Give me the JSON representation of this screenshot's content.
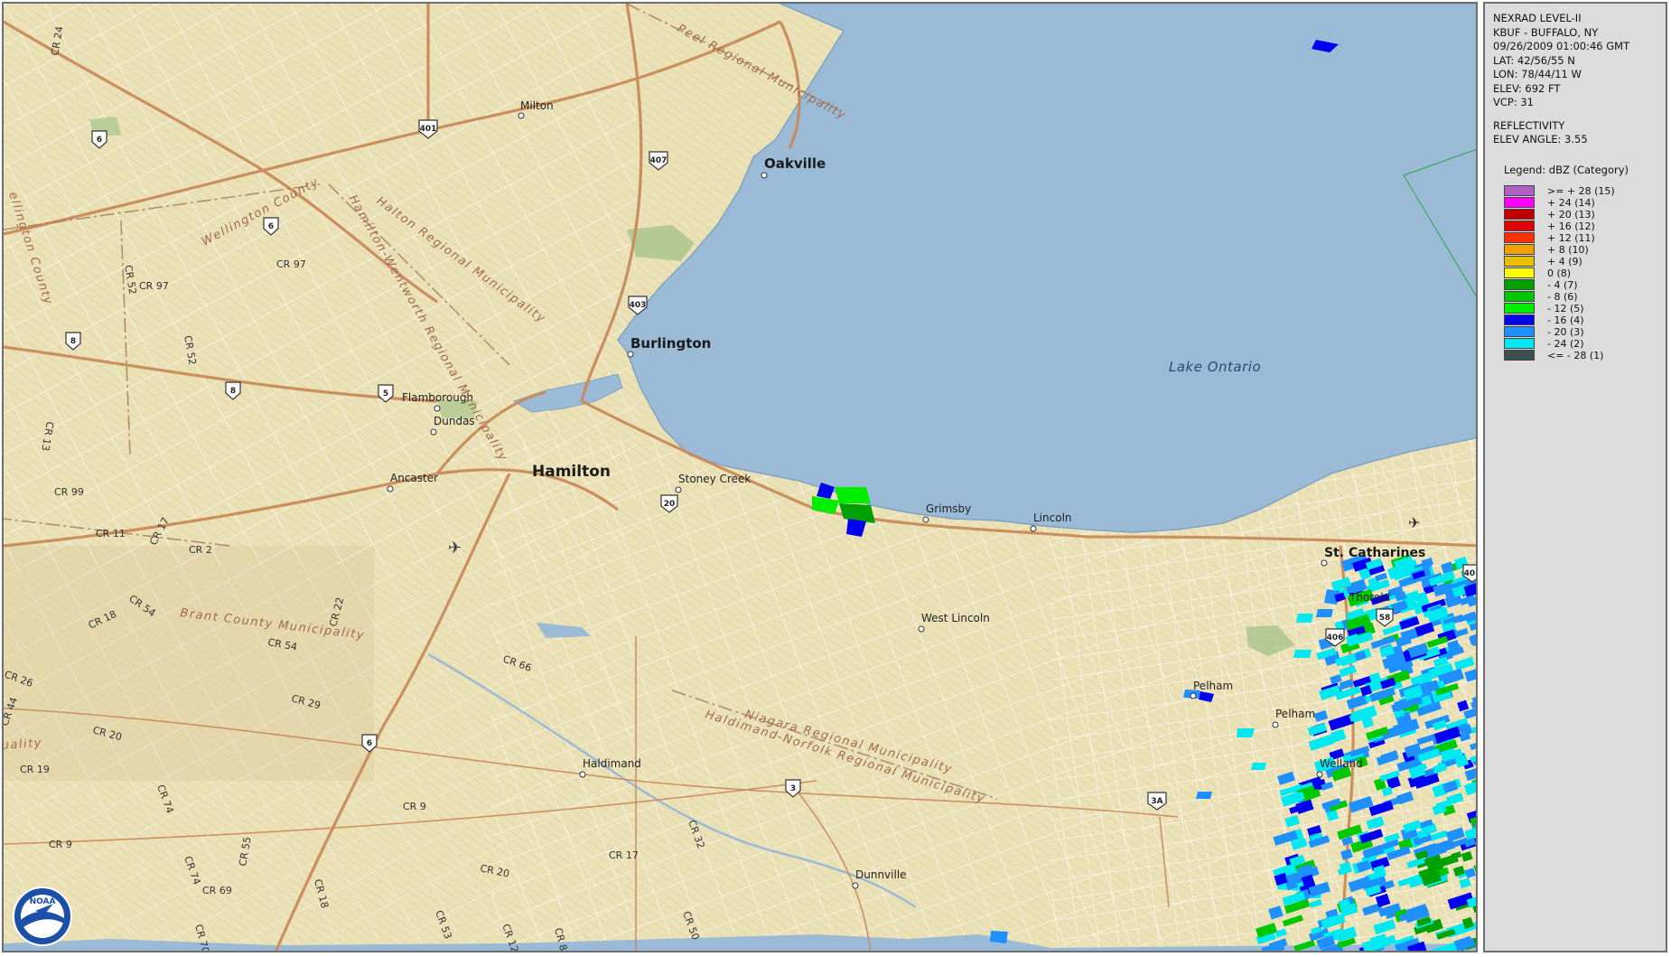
{
  "radar_info": {
    "lines_1": [
      "NEXRAD LEVEL-II",
      "KBUF - BUFFALO, NY",
      "09/26/2009 01:00:46 GMT",
      "LAT: 42/56/55 N",
      "LON: 78/44/11 W",
      "ELEV: 692 FT",
      "VCP: 31"
    ],
    "lines_2": [
      "REFLECTIVITY",
      "ELEV ANGLE: 3.55"
    ]
  },
  "legend": {
    "title": "Legend: dBZ (Category)",
    "items": [
      {
        "label": ">= + 28 (15)",
        "color": "#b060c8"
      },
      {
        "label": "+ 24 (14)",
        "color": "#ff00ff"
      },
      {
        "label": "+ 20 (13)",
        "color": "#c00000"
      },
      {
        "label": "+ 16 (12)",
        "color": "#e00000"
      },
      {
        "label": "+ 12 (11)",
        "color": "#ff3000"
      },
      {
        "label": "+ 8 (10)",
        "color": "#f0a000"
      },
      {
        "label": "+ 4 (9)",
        "color": "#e8c000"
      },
      {
        "label": "0 (8)",
        "color": "#ffff00"
      },
      {
        "label": "- 4 (7)",
        "color": "#00a000"
      },
      {
        "label": "- 8 (6)",
        "color": "#00c800"
      },
      {
        "label": "- 12 (5)",
        "color": "#00ee00"
      },
      {
        "label": "- 16 (4)",
        "color": "#0000f0"
      },
      {
        "label": "- 20 (3)",
        "color": "#1e90ff"
      },
      {
        "label": "- 24 (2)",
        "color": "#00e8f0"
      },
      {
        "label": "<= - 28 (1)",
        "color": "#3c5050"
      }
    ]
  },
  "map": {
    "lake_label": "Lake Ontario",
    "cities": {
      "milton": "Milton",
      "oakville": "Oakville",
      "burlington": "Burlington",
      "flamborough": "Flamborough",
      "dundas": "Dundas",
      "ancaster": "Ancaster",
      "hamilton": "Hamilton",
      "stoney_creek": "Stoney Creek",
      "grimsby": "Grimsby",
      "lincoln": "Lincoln",
      "st_catharines": "St. Catharines",
      "thorold": "Thorold",
      "west_lincoln": "West Lincoln",
      "pelham_1": "Pelham",
      "pelham_2": "Pelham",
      "welland": "Welland",
      "haldimand": "Haldimand",
      "dunnville": "Dunnville"
    },
    "regions": {
      "peel": "Peel Regional Municipality",
      "halton": "Halton Regional Municipality",
      "hamilton_wentworth": "Hamilton-Wentworth Regional Municipality",
      "wellington": "Wellington County",
      "wellington_2": "ellington County",
      "brant": "Brant County Municipality",
      "niagara": "Niagara Regional Municipality",
      "haldimand_norfolk": "Haldimand-Norfolk Regional Municipality",
      "left_edge": "uality"
    },
    "county_roads": {
      "cr24": "CR 24",
      "cr97a": "CR 97",
      "cr52a": "CR 52",
      "cr97b": "CR 97",
      "cr52b": "CR 52",
      "cr13": "CR 13",
      "cr99": "CR 99",
      "cr11": "CR 11",
      "cr17": "CR 17",
      "cr2": "CR 2",
      "cr54a": "CR 54",
      "cr18": "CR 18",
      "cr22": "CR 22",
      "cr54b": "CR 54",
      "cr26": "CR 26",
      "cr44": "CR 44",
      "cr29": "CR 29",
      "cr20a": "CR 20",
      "cr66": "CR 66",
      "cr19": "CR 19",
      "cr74a": "CR 74",
      "cr9a": "CR 9",
      "cr9b": "CR 9",
      "cr74b": "CR 74",
      "cr69": "CR 69",
      "cr55": "CR 55",
      "cr18b": "CR 18",
      "cr53": "CR 53",
      "cr12": "CR 12",
      "cr8": "CR 8",
      "cr70": "CR 70",
      "cr17b": "CR 17",
      "cr20b": "CR 20",
      "cr32": "CR 32",
      "cr50": "CR 50"
    },
    "shields": {
      "h401": "401",
      "h407": "407",
      "h403": "403",
      "h6a": "6",
      "h6b": "6",
      "h8a": "8",
      "h8b": "8",
      "h5": "5",
      "h20": "20",
      "h6c": "6",
      "h3": "3",
      "h3a": "3A",
      "h406": "406",
      "h58": "58",
      "h405": "405"
    },
    "logo_text": "NOAA"
  }
}
